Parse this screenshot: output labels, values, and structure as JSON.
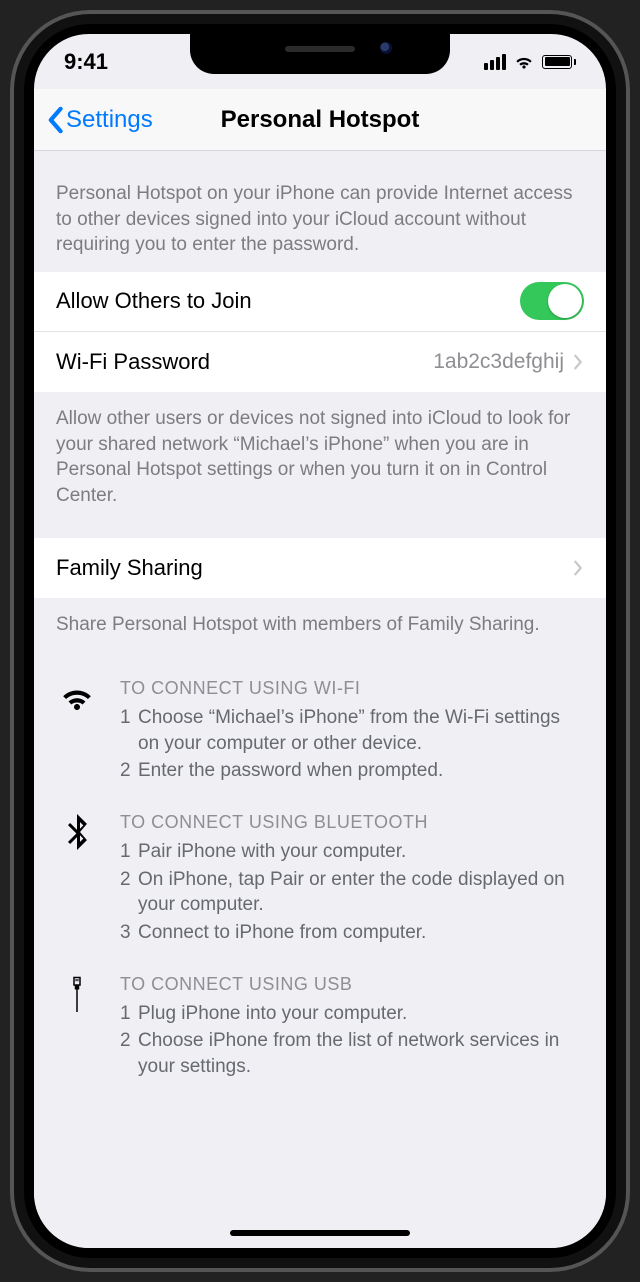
{
  "statusbar": {
    "time": "9:41"
  },
  "nav": {
    "back": "Settings",
    "title": "Personal Hotspot"
  },
  "intro": "Personal Hotspot on your iPhone can provide Internet access to other devices signed into your iCloud account without requiring you to enter the password.",
  "rows": {
    "allow": {
      "label": "Allow Others to Join",
      "on": true
    },
    "pw": {
      "label": "Wi-Fi Password",
      "value": "1ab2c3defghij"
    },
    "family": {
      "label": "Family Sharing"
    }
  },
  "allowFooter": "Allow other users or devices not signed into iCloud to look for your shared network “Michael’s iPhone” when you are in Personal Hotspot settings or when you turn it on in Control Center.",
  "familyFooter": "Share Personal Hotspot with members of Family Sharing.",
  "instructions": [
    {
      "icon": "wifi",
      "heading": "TO CONNECT USING WI-FI",
      "steps": [
        "Choose “Michael’s iPhone” from the Wi-Fi settings on your computer or other device.",
        "Enter the password when prompted."
      ]
    },
    {
      "icon": "bluetooth",
      "heading": "TO CONNECT USING BLUETOOTH",
      "steps": [
        "Pair iPhone with your computer.",
        "On iPhone, tap Pair or enter the code displayed on your computer.",
        "Connect to iPhone from computer."
      ]
    },
    {
      "icon": "usb",
      "heading": "TO CONNECT USING USB",
      "steps": [
        "Plug iPhone into your computer.",
        "Choose iPhone from the list of network services in your settings."
      ]
    }
  ]
}
